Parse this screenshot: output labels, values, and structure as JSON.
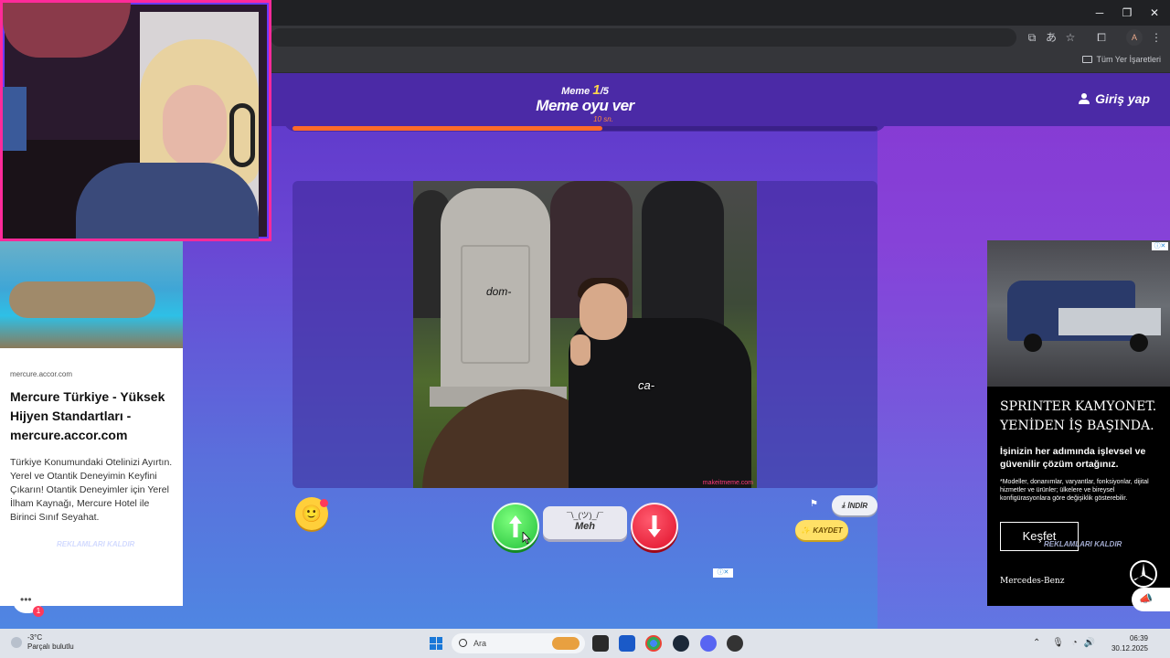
{
  "browser": {
    "window_controls": {
      "minimize": "─",
      "maximize": "❐",
      "close": "✕"
    },
    "toolbar_icons": [
      "install-icon",
      "translate-icon",
      "star-icon",
      "extensions-icon",
      "profile-avatar",
      "menu-icon"
    ],
    "profile_initial": "A",
    "bookmarks_all_label": "Tüm Yer İşaretleri"
  },
  "header": {
    "meme_label": "Meme",
    "meme_current": "1",
    "meme_total": "/5",
    "title": "Meme oyu ver",
    "timer": "10 sn.",
    "progress": 0.53,
    "login_label": "Giriş yap"
  },
  "meme": {
    "caption_top": "dom-",
    "caption_bottom": "ca-",
    "watermark": "makeitmeme.com"
  },
  "controls": {
    "meh_face": "¯\\_(ツ)_/¯",
    "meh_label": "Meh",
    "download_label": "İNDİR",
    "save_label": "KAYDET"
  },
  "ads": {
    "left": {
      "domain": "mercure.accor.com",
      "title": "Mercure Türkiye - Yüksek Hijyen Standartları - mercure.accor.com",
      "body": "Türkiye Konumundaki Otelinizi Ayırtın. Yerel ve Otantik Deneyimin Keyfini Çıkarın! Otantik Deneyimler için Yerel İlham Kaynağı, Mercure Hotel ile Birinci Sınıf Seyahat.",
      "remove_label": "REKLAMLARI KALDIR"
    },
    "right": {
      "headline": "SPRINTER KAMYONET. YENİDEN İŞ BAŞINDA.",
      "text": "İşinizin her adımında işlevsel ve güvenilir çözüm ortağınız.",
      "small": "*Modeller, donanımlar, varyantlar, fonksiyonlar, dijital hizmetler ve ürünler; ülkelere ve bireysel konfigürasyonlara göre değişiklik gösterebilir.",
      "cta": "Keşfet",
      "brand": "Mercedes-Benz",
      "remove_label": "REKLAMLARI KALDIR"
    },
    "adchoices": "ⓘ✕"
  },
  "chat": {
    "badge": "1"
  },
  "taskbar": {
    "weather_temp": "-3°C",
    "weather_desc": "Parçalı bulutlu",
    "search_placeholder": "Ara",
    "time": "06:39",
    "date": "30.12.2025"
  }
}
